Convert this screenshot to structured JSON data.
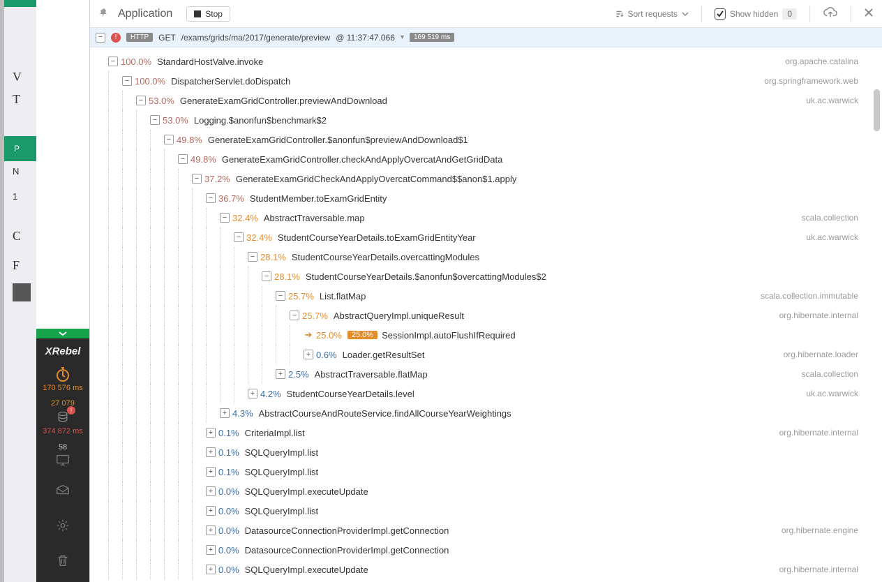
{
  "toolbar": {
    "title": "Application",
    "stop": "Stop",
    "sort": "Sort requests",
    "show_hidden": "Show hidden",
    "hidden_count": "0"
  },
  "request": {
    "method": "GET",
    "path": "/exams/grids/ma/2017/generate/preview",
    "at": "@ 11:37:47.066",
    "duration": "169 519 ms",
    "http_label": "HTTP"
  },
  "sidebar": {
    "brand": "XRebel",
    "timer": "170 576 ms",
    "calls": "27 079",
    "db": "374 872 ms",
    "io": "58"
  },
  "tree": [
    {
      "d": 0,
      "t": "-",
      "pc": "red",
      "p": "100.0%",
      "m": "StandardHostValve.invoke",
      "pkg": "org.apache.catalina"
    },
    {
      "d": 1,
      "t": "-",
      "pc": "red",
      "p": "100.0%",
      "m": "DispatcherServlet.doDispatch",
      "pkg": "org.springframework.web"
    },
    {
      "d": 2,
      "t": "-",
      "pc": "red",
      "p": "53.0%",
      "m": "GenerateExamGridController.previewAndDownload",
      "pkg": "uk.ac.warwick"
    },
    {
      "d": 3,
      "t": "-",
      "pc": "red",
      "p": "53.0%",
      "m": "Logging.$anonfun$benchmark$2",
      "pkg": ""
    },
    {
      "d": 4,
      "t": "-",
      "pc": "red",
      "p": "49.8%",
      "m": "GenerateExamGridController.$anonfun$previewAndDownload$1",
      "pkg": ""
    },
    {
      "d": 5,
      "t": "-",
      "pc": "red",
      "p": "49.8%",
      "m": "GenerateExamGridController.checkAndApplyOvercatAndGetGridData",
      "pkg": ""
    },
    {
      "d": 6,
      "t": "-",
      "pc": "red",
      "p": "37.2%",
      "m": "GenerateExamGridCheckAndApplyOvercatCommand$$anon$1.apply",
      "pkg": ""
    },
    {
      "d": 7,
      "t": "-",
      "pc": "red",
      "p": "36.7%",
      "m": "StudentMember.toExamGridEntity",
      "pkg": ""
    },
    {
      "d": 8,
      "t": "-",
      "pc": "orange",
      "p": "32.4%",
      "m": "AbstractTraversable.map",
      "pkg": "scala.collection"
    },
    {
      "d": 9,
      "t": "-",
      "pc": "orange",
      "p": "32.4%",
      "m": "StudentCourseYearDetails.toExamGridEntityYear",
      "pkg": "uk.ac.warwick"
    },
    {
      "d": 10,
      "t": "-",
      "pc": "orange",
      "p": "28.1%",
      "m": "StudentCourseYearDetails.overcattingModules",
      "pkg": ""
    },
    {
      "d": 11,
      "t": "-",
      "pc": "orange",
      "p": "28.1%",
      "m": "StudentCourseYearDetails.$anonfun$overcattingModules$2",
      "pkg": ""
    },
    {
      "d": 12,
      "t": "-",
      "pc": "orange",
      "p": "25.7%",
      "m": "List.flatMap",
      "pkg": "scala.collection.immutable"
    },
    {
      "d": 13,
      "t": "-",
      "pc": "orange",
      "p": "25.7%",
      "m": "AbstractQueryImpl.uniqueResult",
      "pkg": "org.hibernate.internal"
    },
    {
      "d": 14,
      "t": ">",
      "pc": "orange",
      "p": "25.0%",
      "m": "SessionImpl.autoFlushIfRequired",
      "pkg": "",
      "badge": "25.0%"
    },
    {
      "d": 14,
      "t": "+",
      "pc": "blue",
      "p": "0.6%",
      "m": "Loader.getResultSet",
      "pkg": "org.hibernate.loader"
    },
    {
      "d": 12,
      "t": "+",
      "pc": "blue",
      "p": "2.5%",
      "m": "AbstractTraversable.flatMap",
      "pkg": "scala.collection"
    },
    {
      "d": 10,
      "t": "+",
      "pc": "blue",
      "p": "4.2%",
      "m": "StudentCourseYearDetails.level",
      "pkg": "uk.ac.warwick"
    },
    {
      "d": 8,
      "t": "+",
      "pc": "blue",
      "p": "4.3%",
      "m": "AbstractCourseAndRouteService.findAllCourseYearWeightings",
      "pkg": ""
    },
    {
      "d": 7,
      "t": "+",
      "pc": "blue",
      "p": "0.1%",
      "m": "CriteriaImpl.list",
      "pkg": "org.hibernate.internal"
    },
    {
      "d": 7,
      "t": "+",
      "pc": "blue",
      "p": "0.1%",
      "m": "SQLQueryImpl.list",
      "pkg": ""
    },
    {
      "d": 7,
      "t": "+",
      "pc": "blue",
      "p": "0.1%",
      "m": "SQLQueryImpl.list",
      "pkg": ""
    },
    {
      "d": 7,
      "t": "+",
      "pc": "blue",
      "p": "0.0%",
      "m": "SQLQueryImpl.executeUpdate",
      "pkg": ""
    },
    {
      "d": 7,
      "t": "+",
      "pc": "blue",
      "p": "0.0%",
      "m": "SQLQueryImpl.list",
      "pkg": ""
    },
    {
      "d": 7,
      "t": "+",
      "pc": "blue",
      "p": "0.0%",
      "m": "DatasourceConnectionProviderImpl.getConnection",
      "pkg": "org.hibernate.engine"
    },
    {
      "d": 7,
      "t": "+",
      "pc": "blue",
      "p": "0.0%",
      "m": "DatasourceConnectionProviderImpl.getConnection",
      "pkg": ""
    },
    {
      "d": 7,
      "t": "+",
      "pc": "blue",
      "p": "0.0%",
      "m": "SQLQueryImpl.executeUpdate",
      "pkg": "org.hibernate.internal"
    }
  ],
  "bg": {
    "p": "P",
    "n": "N",
    "one": "1",
    "c": "C",
    "f": "F"
  }
}
